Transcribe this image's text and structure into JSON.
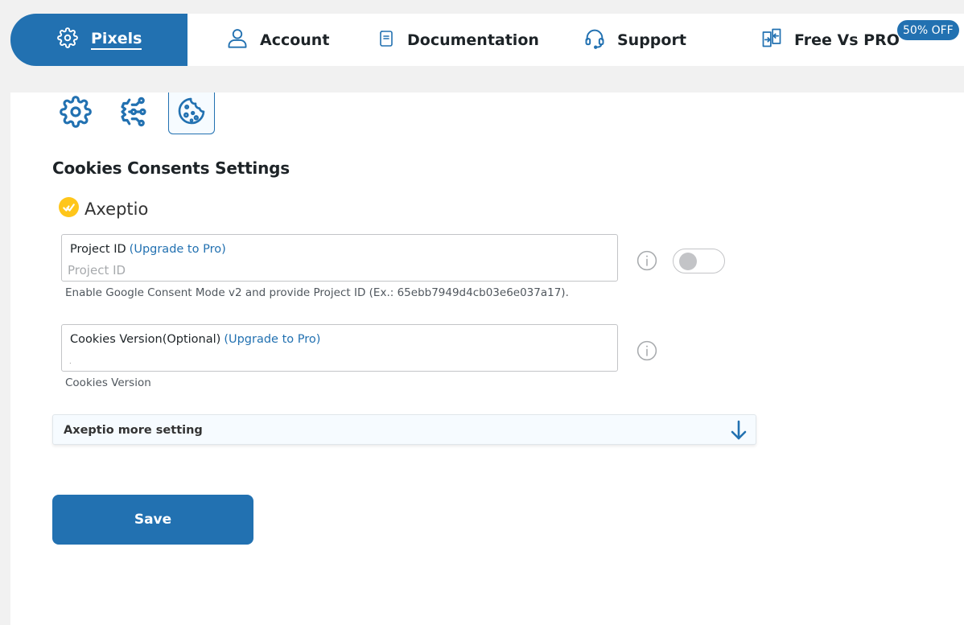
{
  "nav": {
    "items": [
      {
        "label": "Pixels",
        "icon": "gear-icon",
        "active": true
      },
      {
        "label": "Account",
        "icon": "user-icon"
      },
      {
        "label": "Documentation",
        "icon": "document-icon"
      },
      {
        "label": "Support",
        "icon": "headset-icon"
      },
      {
        "label": "Free Vs PRO",
        "icon": "compare-icon"
      }
    ],
    "badge": "50% OFF"
  },
  "tabs": [
    {
      "name": "general-settings",
      "icon": "gear-icon"
    },
    {
      "name": "integrations",
      "icon": "network-icon"
    },
    {
      "name": "cookies",
      "icon": "cookie-icon",
      "selected": true
    }
  ],
  "section": {
    "title": "Cookies Consents Settings",
    "brand": "Axeptio",
    "brand_icon": "axeptio-logo-icon"
  },
  "fields": {
    "project_id": {
      "label": "Project ID",
      "upgrade": "(Upgrade to Pro)",
      "placeholder": "Project ID",
      "help": "Enable Google Consent Mode v2 and provide Project ID (Ex.: 65ebb7949d4cb03e6e037a17)."
    },
    "cookies_version": {
      "label": "Cookies Version(Optional)",
      "upgrade": "(Upgrade to Pro)",
      "value": ".",
      "help": "Cookies Version"
    }
  },
  "accordion": {
    "label": "Axeptio more setting"
  },
  "save_label": "Save",
  "colors": {
    "accent": "#2271b1",
    "axeptio_yellow": "#ffc61a"
  }
}
